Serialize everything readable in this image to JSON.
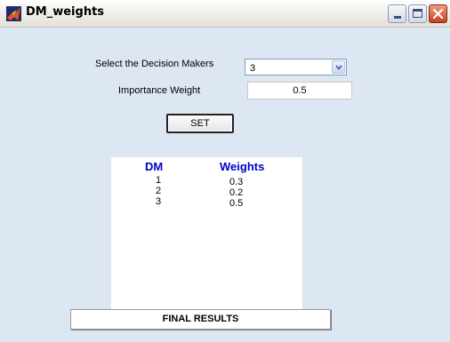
{
  "window": {
    "title": "DM_weights",
    "icon": "matlab-icon",
    "controls": [
      "minimize-icon",
      "maximize-icon",
      "close-icon"
    ]
  },
  "form": {
    "decision_makers_label": "Select the Decision Makers",
    "decision_makers_value": "3",
    "importance_weight_label": "Importance Weight",
    "importance_weight_value": "0.5",
    "set_label": "SET"
  },
  "results": {
    "headers": {
      "dm": "DM",
      "weights": "Weights"
    },
    "rows": [
      {
        "dm": "1",
        "weight": "0.3"
      },
      {
        "dm": "2",
        "weight": "0.2"
      },
      {
        "dm": "3",
        "weight": "0.5"
      }
    ],
    "header_color": "#0000cc"
  },
  "final_results_label": "FINAL RESULTS"
}
